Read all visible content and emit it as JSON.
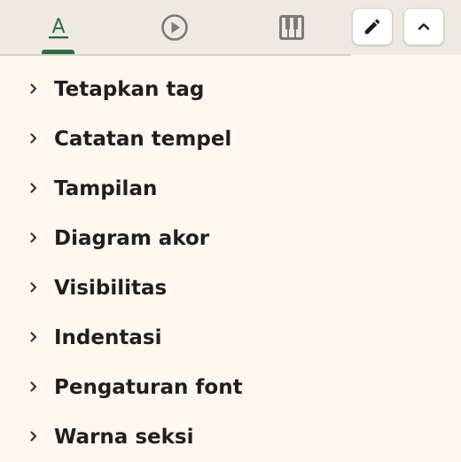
{
  "tabs": [
    {
      "name": "text-format",
      "icon": "text-format-icon",
      "active": true
    },
    {
      "name": "playback",
      "icon": "play-circle-icon",
      "active": false
    },
    {
      "name": "piano",
      "icon": "piano-keys-icon",
      "active": false
    }
  ],
  "toolbar": {
    "edit_icon": "pencil-icon",
    "collapse_icon": "chevron-up-icon"
  },
  "menu": {
    "items": [
      {
        "label": "Tetapkan tag"
      },
      {
        "label": "Catatan tempel"
      },
      {
        "label": "Tampilan"
      },
      {
        "label": "Diagram akor"
      },
      {
        "label": "Visibilitas"
      },
      {
        "label": "Indentasi"
      },
      {
        "label": "Pengaturan font"
      },
      {
        "label": "Warna seksi"
      }
    ]
  },
  "colors": {
    "accent": "#2e6b45",
    "background": "#fff7f0",
    "header_background": "#eeeae3"
  }
}
